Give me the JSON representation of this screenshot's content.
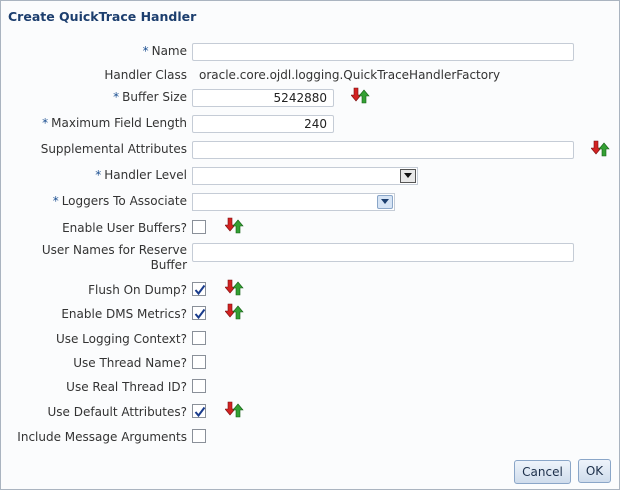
{
  "dialog": {
    "title": "Create QuickTrace Handler"
  },
  "form": {
    "required_marker": "*",
    "name": {
      "label": "Name",
      "value": ""
    },
    "handler_class": {
      "label": "Handler Class",
      "value": "oracle.core.ojdl.logging.QuickTraceHandlerFactory"
    },
    "buffer_size": {
      "label": "Buffer Size",
      "value": "5242880"
    },
    "max_field_length": {
      "label": "Maximum Field Length",
      "value": "240"
    },
    "supplemental_attributes": {
      "label": "Supplemental Attributes",
      "value": ""
    },
    "handler_level": {
      "label": "Handler Level",
      "value": ""
    },
    "loggers_to_associate": {
      "label": "Loggers To Associate",
      "value": ""
    },
    "enable_user_buffers": {
      "label": "Enable User Buffers?",
      "checked": false
    },
    "user_names_reserve_buffer": {
      "label": "User Names for Reserve Buffer",
      "value": ""
    },
    "flush_on_dump": {
      "label": "Flush On Dump?",
      "checked": true
    },
    "enable_dms_metrics": {
      "label": "Enable DMS Metrics?",
      "checked": true
    },
    "use_logging_context": {
      "label": "Use Logging Context?",
      "checked": false
    },
    "use_thread_name": {
      "label": "Use Thread Name?",
      "checked": false
    },
    "use_real_thread_id": {
      "label": "Use Real Thread ID?",
      "checked": false
    },
    "use_default_attributes": {
      "label": "Use Default Attributes?",
      "checked": true
    },
    "include_message_arguments": {
      "label": "Include Message Arguments",
      "checked": false
    }
  },
  "buttons": {
    "cancel": "Cancel",
    "ok": "OK"
  },
  "icons": {
    "reset": "reset-default-icon",
    "dropdown": "chevron-down-icon",
    "checkmark": "checkmark-icon"
  },
  "colors": {
    "title": "#1c3e6e",
    "required": "#1b4f91",
    "reset_up_arrow": "#2e8b2e",
    "reset_down_arrow": "#d22222"
  }
}
